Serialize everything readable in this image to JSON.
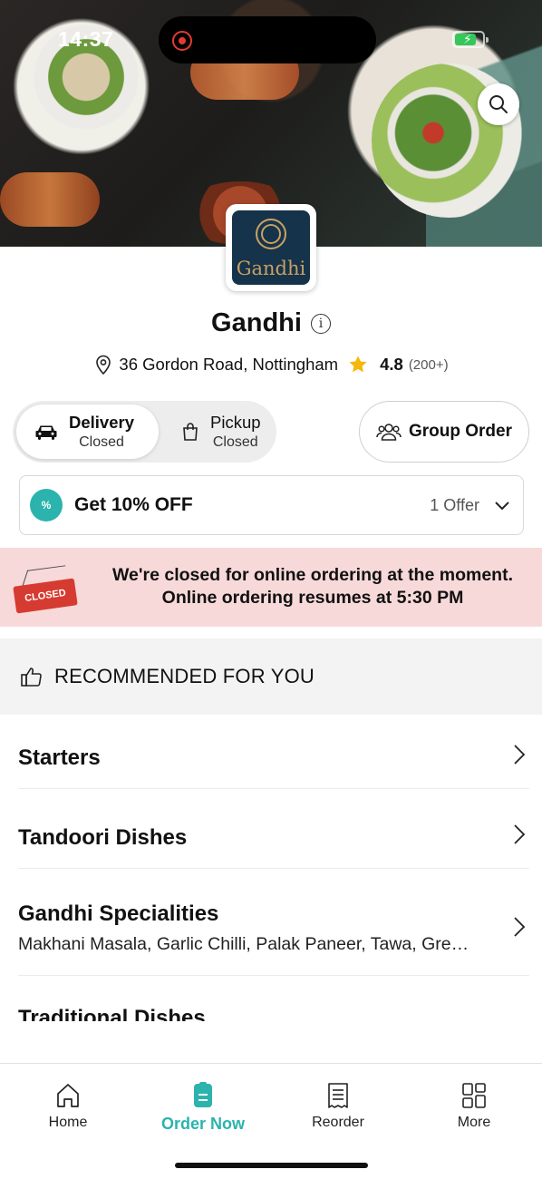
{
  "status_bar": {
    "time": "14:37"
  },
  "restaurant": {
    "name": "Gandhi",
    "logo_text": "Gandhi",
    "address": "36 Gordon Road, Nottingham",
    "rating": "4.8",
    "reviews": "(200+)"
  },
  "order_modes": [
    {
      "label": "Delivery",
      "status": "Closed",
      "selected": true
    },
    {
      "label": "Pickup",
      "status": "Closed",
      "selected": false
    }
  ],
  "group_order_label": "Group Order",
  "offer": {
    "badge": "%",
    "title": "Get 10% OFF",
    "count": "1 Offer"
  },
  "closed_banner": {
    "sign": "CLOSED",
    "line1": "We're closed for online ordering at the moment.",
    "line2": "Online ordering resumes at 5:30 PM"
  },
  "recommended_title": "RECOMMENDED FOR YOU",
  "categories": [
    {
      "name": "Starters"
    },
    {
      "name": "Tandoori Dishes"
    },
    {
      "name": "Gandhi Specialities",
      "description": "Makhani Masala, Garlic Chilli, Palak Paneer, Tawa, Gre…"
    },
    {
      "name": "Traditional Dishes"
    }
  ],
  "tabs": [
    {
      "label": "Home",
      "icon": "home-icon"
    },
    {
      "label": "Order Now",
      "icon": "order-icon"
    },
    {
      "label": "Reorder",
      "icon": "receipt-icon"
    },
    {
      "label": "More",
      "icon": "grid-icon"
    }
  ],
  "colors": {
    "accent": "#2bb3ad",
    "closed_banner_bg": "#f8d9d9",
    "star": "#f5b70a",
    "closed_sign": "#d63b31"
  }
}
